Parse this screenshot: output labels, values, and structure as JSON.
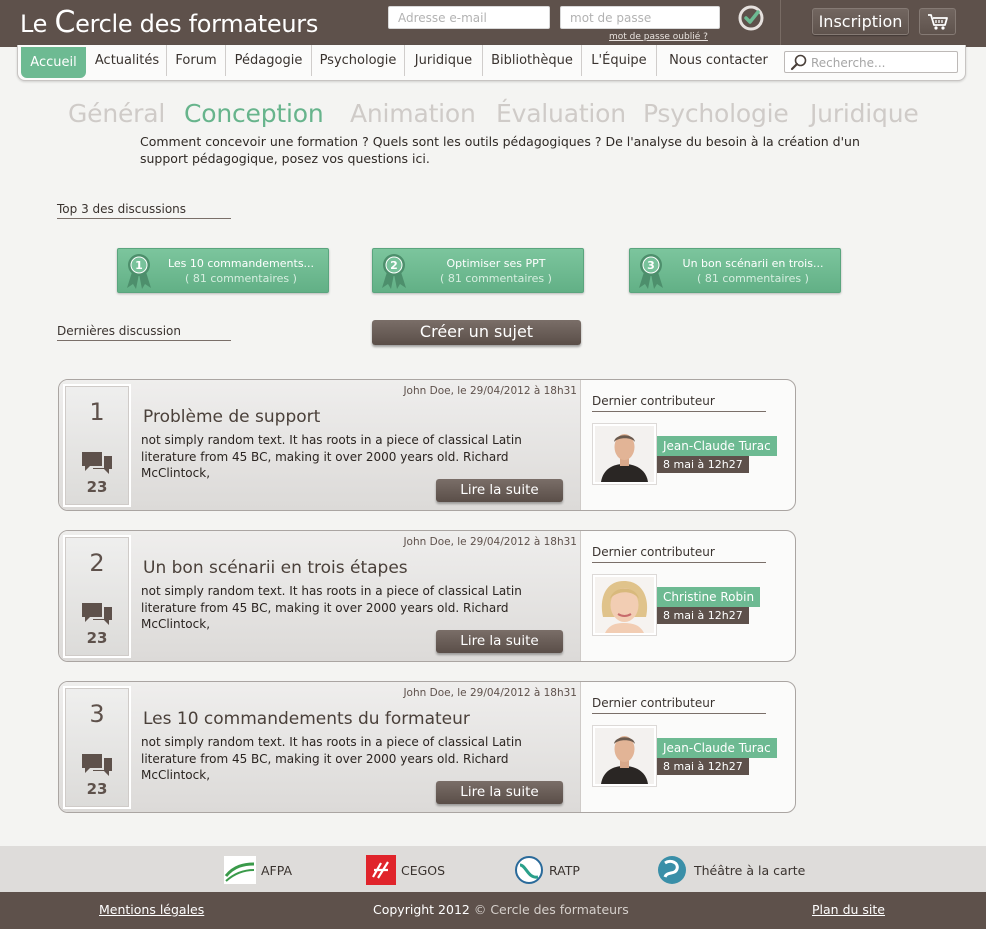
{
  "header": {
    "logo_text": "Le Cercle des formateurs",
    "logo_prefix": "Le ",
    "logo_c": "C",
    "logo_rest": "ercle des formateurs",
    "email_placeholder": "Adresse e-mail",
    "password_placeholder": "mot de passe",
    "forgot_password": "mot de passe oublié ?",
    "signup_label": "Inscription"
  },
  "nav": {
    "items": [
      {
        "label": "Accueil",
        "active": true
      },
      {
        "label": "Actualités"
      },
      {
        "label": "Forum"
      },
      {
        "label": "Pédagogie"
      },
      {
        "label": "Psychologie"
      },
      {
        "label": "Juridique"
      },
      {
        "label": "Bibliothèque"
      },
      {
        "label": "L'Équipe"
      },
      {
        "label": "Nous contacter"
      }
    ],
    "search_placeholder": "Recherche..."
  },
  "categories": [
    {
      "label": "Général"
    },
    {
      "label": "Conception",
      "active": true
    },
    {
      "label": "Animation"
    },
    {
      "label": "Évaluation"
    },
    {
      "label": "Psychologie"
    },
    {
      "label": "Juridique"
    }
  ],
  "intro": "Comment concevoir une formation ? Quels sont les outils pédagogiques ? De l'analyse du besoin à la création d'un support pédagogique, posez vos questions ici.",
  "top3": {
    "heading": "Top 3 des discussions",
    "items": [
      {
        "rank": "1",
        "title": "Les 10 commandements...",
        "count": "( 81 commentaires )"
      },
      {
        "rank": "2",
        "title": "Optimiser ses PPT",
        "count": "( 81 commentaires )"
      },
      {
        "rank": "3",
        "title": "Un bon scénarii en trois...",
        "count": "( 81 commentaires )"
      }
    ]
  },
  "latest": {
    "heading": "Dernières discussion",
    "create_label": "Créer un sujet",
    "items": [
      {
        "rank": "1",
        "comments": "23",
        "meta": "John Doe, le 29/04/2012 à 18h31",
        "title": "Problème de support",
        "excerpt": "not simply random text. It has roots in a piece of classical Latin literature from 45 BC, making it over 2000 years old. Richard McClintock,",
        "more_label": "Lire la suite",
        "contrib_heading": "Dernier contributeur",
        "contrib_name": "Jean-Claude Turac",
        "contrib_date": "8 mai à 12h27"
      },
      {
        "rank": "2",
        "comments": "23",
        "meta": "John Doe, le 29/04/2012 à 18h31",
        "title": "Un bon scénarii en trois étapes",
        "excerpt": "not simply random text. It has roots in a piece of classical Latin literature from 45 BC, making it over 2000 years old. Richard McClintock,",
        "more_label": "Lire la suite",
        "contrib_heading": "Dernier contributeur",
        "contrib_name": "Christine Robin",
        "contrib_date": "8 mai à 12h27"
      },
      {
        "rank": "3",
        "comments": "23",
        "meta": "John Doe, le 29/04/2012 à 18h31",
        "title": "Les 10 commandements du formateur",
        "excerpt": "not simply random text. It has roots in a piece of classical Latin literature from 45 BC, making it over 2000 years old. Richard McClintock,",
        "more_label": "Lire la suite",
        "contrib_heading": "Dernier contributeur",
        "contrib_name": "Jean-Claude Turac",
        "contrib_date": "8 mai à 12h27"
      }
    ]
  },
  "partners": [
    {
      "label": "AFPA",
      "icon": "afpa-logo"
    },
    {
      "label": "CEGOS",
      "icon": "cegos-logo"
    },
    {
      "label": "RATP",
      "icon": "ratp-logo"
    },
    {
      "label": "Théâtre à la carte",
      "icon": "theatre-logo"
    }
  ],
  "footer": {
    "legal": "Mentions légales",
    "copyright_bold": "Copyright 2012",
    "copyright_rest": "© Cercle des formateurs",
    "sitemap": "Plan du site"
  },
  "colors": {
    "brown": "#5e514b",
    "green": "#6dba92",
    "light_gray": "#cfcbc8"
  }
}
